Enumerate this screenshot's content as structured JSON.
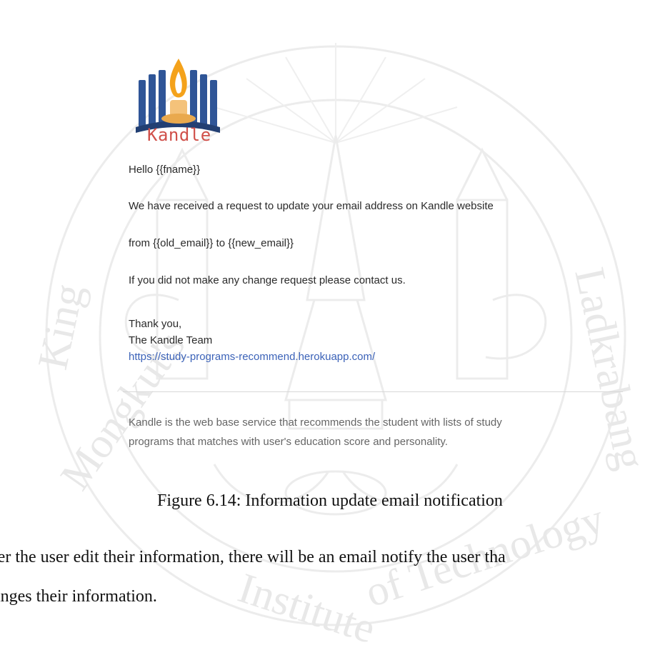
{
  "logo": {
    "brand_text": "Kandle"
  },
  "email": {
    "greeting": "Hello {{fname}}",
    "line1": "We have received a request to update your email address on Kandle website",
    "line2": "from {{old_email}} to {{new_email}}",
    "line3": "If you did not make any change request please contact us.",
    "signoff1": "Thank you,",
    "signoff2": "The Kandle Team",
    "link": "https://study-programs-recommend.herokuapp.com/",
    "footer1": "Kandle is the web base service that recommends the student with lists of study",
    "footer2": "programs that matches with user's education score and personality."
  },
  "caption": "Figure 6.14: Information update email notification",
  "body_text": {
    "line1": "ter the user edit their information, there will be an email notify the user tha",
    "line2": "anges their information."
  },
  "watermark": {
    "arc_left": "King Mongkut's",
    "arc_right": "Ladkrabang",
    "arc_bottom": "Institute of Technology"
  },
  "colors": {
    "logo_book": "#2f5597",
    "logo_word": "#d0504a",
    "link": "#3b62b8",
    "watermark": "#e6e6e6"
  }
}
